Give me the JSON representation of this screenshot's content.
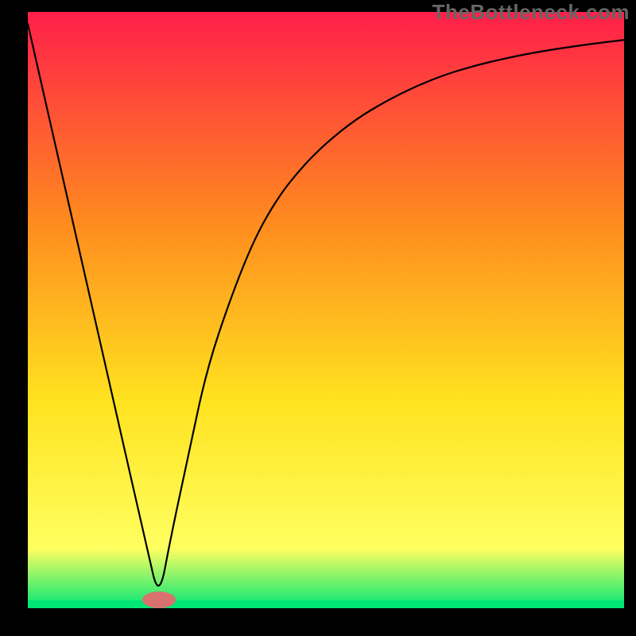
{
  "watermark": "TheBottleneck.com",
  "chart_data": {
    "type": "line",
    "title": "",
    "xlabel": "",
    "ylabel": "",
    "xlim": [
      0,
      100
    ],
    "ylim": [
      0,
      100
    ],
    "grid": false,
    "axes_visible": false,
    "background_gradient": {
      "top": "#ff1f4a",
      "mid1": "#ff8a1f",
      "mid2": "#ffe21f",
      "mid3": "#ffff60",
      "bottom": "#00e676"
    },
    "marker": {
      "x": 22,
      "y": 1.4,
      "color": "#d9716e",
      "rx": 2.8,
      "ry": 1.4
    },
    "series": [
      {
        "name": "curve",
        "x": [
          0,
          5,
          10,
          15,
          20,
          22,
          24,
          27,
          30,
          34,
          38,
          42,
          46,
          50,
          55,
          60,
          65,
          70,
          75,
          80,
          85,
          90,
          95,
          100
        ],
        "values": [
          98,
          76,
          54,
          32,
          10,
          1.4,
          12,
          26,
          40,
          52,
          62,
          69,
          74,
          78,
          82,
          85,
          87.5,
          89.5,
          91,
          92.2,
          93.2,
          94,
          94.7,
          95.3
        ]
      }
    ]
  }
}
